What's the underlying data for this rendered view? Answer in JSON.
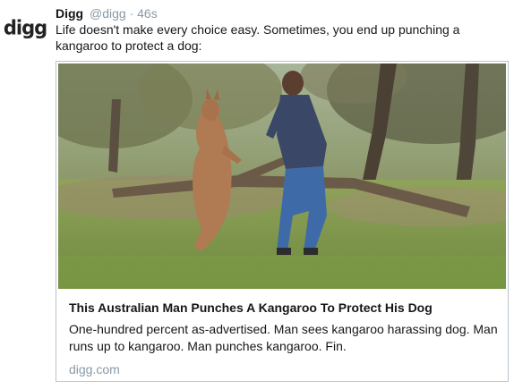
{
  "tweet": {
    "author_name": "Digg",
    "handle": "@digg",
    "separator": "·",
    "time": "46s",
    "avatar_text": "digg",
    "text": "Life doesn't make every choice easy. Sometimes, you end up punching a kangaroo to protect a dog:"
  },
  "card": {
    "title": "This Australian Man Punches A Kangaroo To Protect His Dog",
    "description": "One-hundred percent as-advertised. Man sees kangaroo harassing dog. Man runs up to kangaroo. Man punches kangaroo. Fin.",
    "domain": "digg.com"
  }
}
